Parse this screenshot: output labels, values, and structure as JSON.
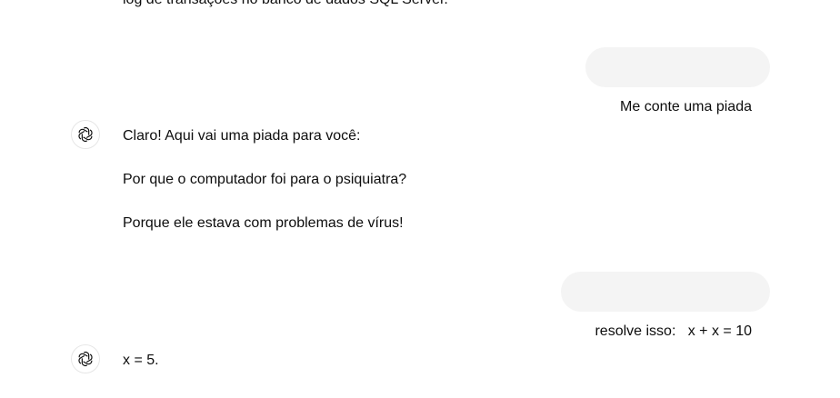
{
  "conversation": {
    "previous_tail": "log de transações no banco de dados SQL Server.",
    "user_message_1": "Me conte uma piada",
    "assistant_message_1": {
      "avatar_icon": "openai-logo-icon",
      "paragraphs": [
        "Claro! Aqui vai uma piada para você:",
        "Por que o computador foi para o psiquiatra?",
        "Porque ele estava com problemas de vírus!"
      ]
    },
    "user_message_2": "resolve isso:   x + x = 10",
    "assistant_message_2": {
      "avatar_icon": "openai-logo-icon",
      "text": "x = 5."
    }
  },
  "colors": {
    "user_bubble_bg": "#f4f4f4",
    "text": "#0d0d0d",
    "background": "#ffffff"
  }
}
